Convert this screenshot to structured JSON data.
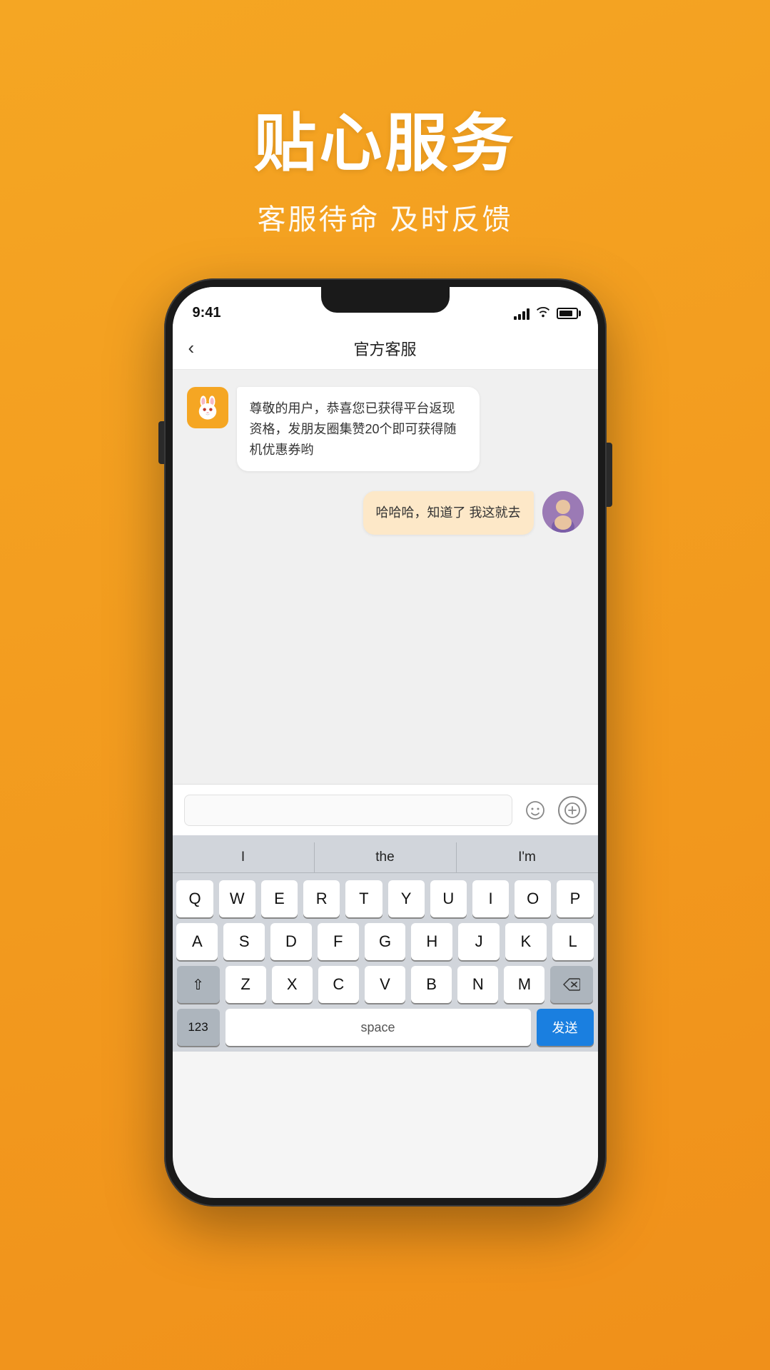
{
  "page": {
    "background": "#f5a623"
  },
  "header": {
    "title": "贴心服务",
    "subtitle": "客服待命 及时反馈"
  },
  "phone": {
    "status_bar": {
      "time": "9:41",
      "signal": "●●●●",
      "wifi": "wifi",
      "battery": "battery"
    },
    "nav": {
      "back_label": "‹",
      "title": "官方客服"
    },
    "chat": {
      "bot_message": "尊敬的用户，恭喜您已获得平台返现资格，发朋友圈集赞20个即可获得随机优惠券哟",
      "user_message": "哈哈哈，知道了 我这就去"
    },
    "input": {
      "placeholder": "",
      "emoji_label": "☺",
      "plus_label": "+"
    },
    "keyboard": {
      "autocomplete": [
        "I",
        "the",
        "I'm"
      ],
      "rows": [
        [
          "Q",
          "W",
          "E",
          "R",
          "T",
          "Y",
          "U",
          "I",
          "O",
          "P"
        ],
        [
          "A",
          "S",
          "D",
          "F",
          "G",
          "H",
          "J",
          "K",
          "L"
        ],
        [
          "⇧",
          "Z",
          "X",
          "C",
          "V",
          "B",
          "N",
          "M",
          "⌫"
        ],
        [
          "123",
          "space",
          "发送"
        ]
      ]
    }
  }
}
